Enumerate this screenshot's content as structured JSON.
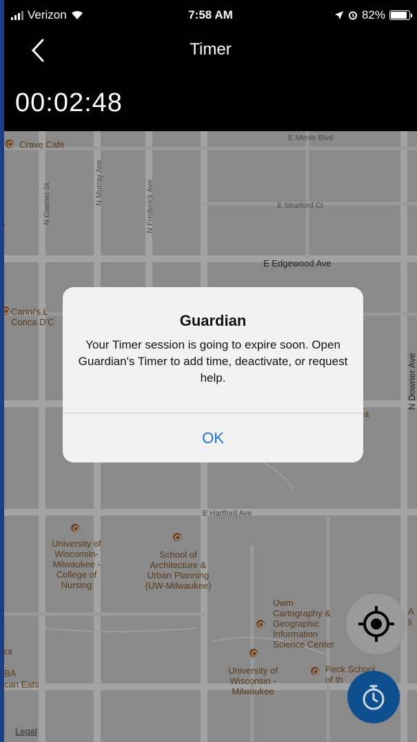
{
  "status_bar": {
    "carrier": "Verizon",
    "time": "7:58 AM",
    "battery": "82%",
    "battery_level": 0.82
  },
  "nav": {
    "title": "Timer"
  },
  "timer": {
    "elapsed": "00:02:48"
  },
  "map": {
    "streets": {
      "menlo": "E Menlo Blvd",
      "stratford": "E Stratford Ct",
      "edgewood": "E Edgewood Ave",
      "hartford": "E Hartford Ave",
      "cramer": "N Cramer St",
      "murray": "N Murray Ave",
      "frederick": "N Frederick Ave",
      "downer": "N Downer Ave"
    },
    "pois": {
      "crave": "Crave Cafe",
      "carinis": "Carini's L\nConca D'C",
      "nursing": "University of\nWisconsin-\nMilwaukee -\nCollege of\nNursing",
      "architecture": "School of\nArchitecture &\nUrban Planning\n(UW-Milwaukee)",
      "cartography": "Uwm\nCartography &\nGeographic\nInformation\nScience Center",
      "uwm": "University of\nWisconsin -\nMilwaukee",
      "peck": "Peck School\nof th",
      "edge_a": "A",
      "edge_li": "li",
      "edge_za": "za",
      "edge_ba": "BA",
      "edge_can_eats": "can Eats",
      "edge_r": "r",
      "edge_a2": "a"
    },
    "legal": "Legal"
  },
  "alert": {
    "title": "Guardian",
    "message": "Your Timer session is going to expire soon. Open Guardian's Timer to add time, deactivate, or request help.",
    "ok_label": "OK"
  },
  "icons": {
    "back": "chevron-left-icon",
    "locate": "crosshair-icon",
    "timer": "stopwatch-icon"
  },
  "colors": {
    "accent": "#1a73e8",
    "fab": "#0d4f8f",
    "poi": "#6e4422"
  }
}
